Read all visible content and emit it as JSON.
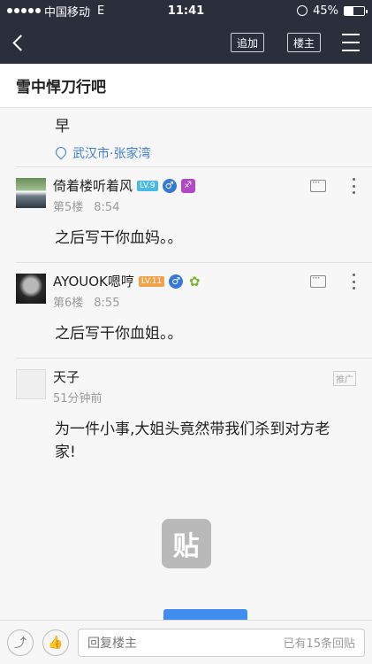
{
  "status": {
    "carrier": "中国移动",
    "network": "E",
    "time": "11:41",
    "battery": "45%",
    "battery_level": 0.45
  },
  "nav": {
    "add_label": "追加",
    "owner_label": "楼主"
  },
  "forum": {
    "title": "雪中悍刀行吧"
  },
  "tail": {
    "text": "早",
    "location": "武汉市·张家湾"
  },
  "posts": [
    {
      "name": "倚着楼听着风",
      "level": "LV.9",
      "floor": "第5楼",
      "time": "8:54",
      "body": "之后写干你血妈。。"
    },
    {
      "name": "AYOUOK嗯哼",
      "level": "LV.11",
      "floor": "第6楼",
      "time": "8:55",
      "body": "之后写干你血姐。。"
    }
  ],
  "ad": {
    "name": "天子",
    "time": "51分钟前",
    "tag": "推广",
    "body": "为一件小事,大姐头竟然带我们杀到对方老家!",
    "watermark": "贴"
  },
  "bottom": {
    "reply_placeholder": "回复楼主",
    "reply_count": "已有15条回贴"
  },
  "icons": {
    "share": "share-icon",
    "like": "thumbs-up-icon",
    "reply": "comment-icon",
    "more": "more-vertical-icon",
    "back": "chevron-left-icon",
    "menu": "hamburger-icon",
    "location": "location-pin-icon"
  },
  "colors": {
    "bar": "#2a2f3b",
    "accent": "#3f8ef0",
    "link": "#3f7fd0"
  }
}
